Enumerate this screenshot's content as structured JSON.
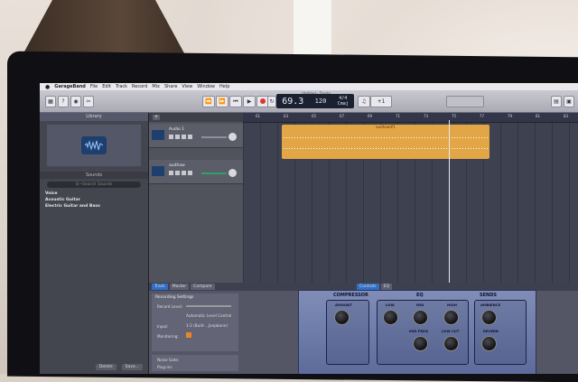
{
  "menubar": {
    "apple": "",
    "items": [
      "GarageBand",
      "File",
      "Edit",
      "Track",
      "Record",
      "Mix",
      "Share",
      "View",
      "Window",
      "Help"
    ]
  },
  "toolbar": {
    "window_title": "Untitled - Tracks",
    "lcd_bar": "69.3",
    "lcd_tempo": "120",
    "lcd_sig": "4/4",
    "lcd_key": "Cmaj",
    "tuner_label": "+1"
  },
  "library": {
    "title": "Library",
    "sounds_header": "Sounds",
    "search_placeholder": "Q~Search Sounds",
    "items": [
      "Voice",
      "Acoustic Guitar",
      "Electric Guitar and Bass"
    ],
    "delete_label": "Delete",
    "save_label": "Save..."
  },
  "tracks": [
    {
      "name": "Audio 1"
    },
    {
      "name": "audhaw"
    }
  ],
  "ruler_ticks": [
    "61",
    "63",
    "65",
    "67",
    "69",
    "71",
    "73",
    "75",
    "77",
    "79",
    "81",
    "83"
  ],
  "region": {
    "title": "audhaw#1"
  },
  "editor": {
    "tabs": [
      "Track",
      "Master",
      "Compare"
    ],
    "mid_tabs": [
      "Controls",
      "EQ"
    ],
    "rec_settings_title": "Recording Settings",
    "record_level_label": "Record Level:",
    "auto_level_label": "Automatic Level Control",
    "input_label": "Input:",
    "input_value": "1-2 (Built-...Jonpbone)",
    "monitoring_label": "Monitoring:",
    "noise_gate_label": "Noise Gate:",
    "plugins_label": "Plug-ins"
  },
  "amp": {
    "compressor_label": "COMPRESSOR",
    "eq_label": "EQ",
    "sends_label": "SENDS",
    "knobs": [
      "AMOUNT",
      "LOW",
      "MID",
      "HIGH",
      "MID FREQ",
      "LOW CUT",
      "AMBIENCE",
      "REVERB"
    ]
  }
}
